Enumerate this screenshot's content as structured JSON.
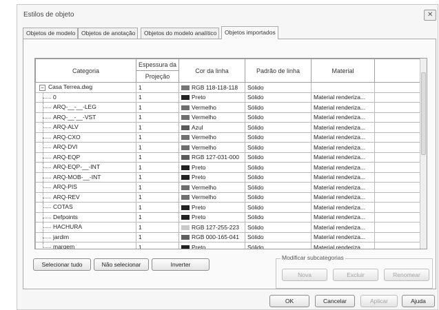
{
  "window": {
    "title": "Estilos de objeto"
  },
  "tabs": [
    "Objetos de modelo",
    "Objetos de anotação",
    "Objetos do modelo analítico",
    "Objetos importados"
  ],
  "active_tab": 3,
  "grid": {
    "headers": {
      "category": "Categoria",
      "thickness": "Espessura da",
      "projection": "Projeção",
      "line_color": "Cor da linha",
      "line_pattern": "Padrão de linha",
      "material": "Material"
    },
    "root": {
      "expander": "−",
      "category": "Casa Terrea.dwg",
      "thickness": "1",
      "color": "RGB 118-118-118",
      "swatch": "#767676",
      "pattern": "Sólido",
      "material": ""
    },
    "rows": [
      {
        "category": "0",
        "thickness": "1",
        "color": "Preto",
        "swatch": "#222222",
        "pattern": "Sólido",
        "material": "Material renderiza..."
      },
      {
        "category": "ARQ-__-__-LEG",
        "thickness": "1",
        "color": "Vermelho",
        "swatch": "#6e6e6e",
        "pattern": "Sólido",
        "material": "Material renderiza..."
      },
      {
        "category": "ARQ-__-__-VST",
        "thickness": "1",
        "color": "Vermelho",
        "swatch": "#6e6e6e",
        "pattern": "Sólido",
        "material": "Material renderiza..."
      },
      {
        "category": "ARQ-ALV",
        "thickness": "1",
        "color": "Azul",
        "swatch": "#5a5a5a",
        "pattern": "Sólido",
        "material": "Material renderiza..."
      },
      {
        "category": "ARQ-CXO",
        "thickness": "1",
        "color": "Vermelho",
        "swatch": "#6e6e6e",
        "pattern": "Sólido",
        "material": "Material renderiza..."
      },
      {
        "category": "ARQ-DVI",
        "thickness": "1",
        "color": "Vermelho",
        "swatch": "#6e6e6e",
        "pattern": "Sólido",
        "material": "Material renderiza..."
      },
      {
        "category": "ARQ-EQP",
        "thickness": "1",
        "color": "RGB 127-031-000",
        "swatch": "#5c5c5c",
        "pattern": "Sólido",
        "material": "Material renderiza..."
      },
      {
        "category": "ARQ-EQP-__-INT",
        "thickness": "1",
        "color": "Preto",
        "swatch": "#222222",
        "pattern": "Sólido",
        "material": "Material renderiza..."
      },
      {
        "category": "ARQ-MOB-__-INT",
        "thickness": "1",
        "color": "Preto",
        "swatch": "#222222",
        "pattern": "Sólido",
        "material": "Material renderiza..."
      },
      {
        "category": "ARQ-PIS",
        "thickness": "1",
        "color": "Vermelho",
        "swatch": "#6e6e6e",
        "pattern": "Sólido",
        "material": "Material renderiza..."
      },
      {
        "category": "ARQ-REV",
        "thickness": "1",
        "color": "Vermelho",
        "swatch": "#6e6e6e",
        "pattern": "Sólido",
        "material": "Material renderiza..."
      },
      {
        "category": "COTAS",
        "thickness": "1",
        "color": "Preto",
        "swatch": "#222222",
        "pattern": "Sólido",
        "material": "Material renderiza..."
      },
      {
        "category": "Defpoints",
        "thickness": "1",
        "color": "Preto",
        "swatch": "#222222",
        "pattern": "Sólido",
        "material": "Material renderiza..."
      },
      {
        "category": "HACHURA",
        "thickness": "1",
        "color": "RGB 127-255-223",
        "swatch": "#c8c8c8",
        "pattern": "Sólido",
        "material": "Material renderiza..."
      },
      {
        "category": "jardim",
        "thickness": "1",
        "color": "RGB 000-165-041",
        "swatch": "#5e5e5e",
        "pattern": "Sólido",
        "material": "Material renderiza..."
      },
      {
        "category": "margem",
        "thickness": "1",
        "color": "Preto",
        "swatch": "#222222",
        "pattern": "Sólido",
        "material": "Material renderiza..."
      }
    ]
  },
  "buttons": {
    "select_all": "Selecionar tudo",
    "select_none": "Não selecionar",
    "invert": "Inverter",
    "ok": "OK",
    "cancel": "Cancelar",
    "apply": "Aplicar",
    "help": "Ajuda"
  },
  "subcategories": {
    "title": "Modificar subcategorias",
    "new": "Nova",
    "delete": "Excluir",
    "rename": "Renomear"
  }
}
